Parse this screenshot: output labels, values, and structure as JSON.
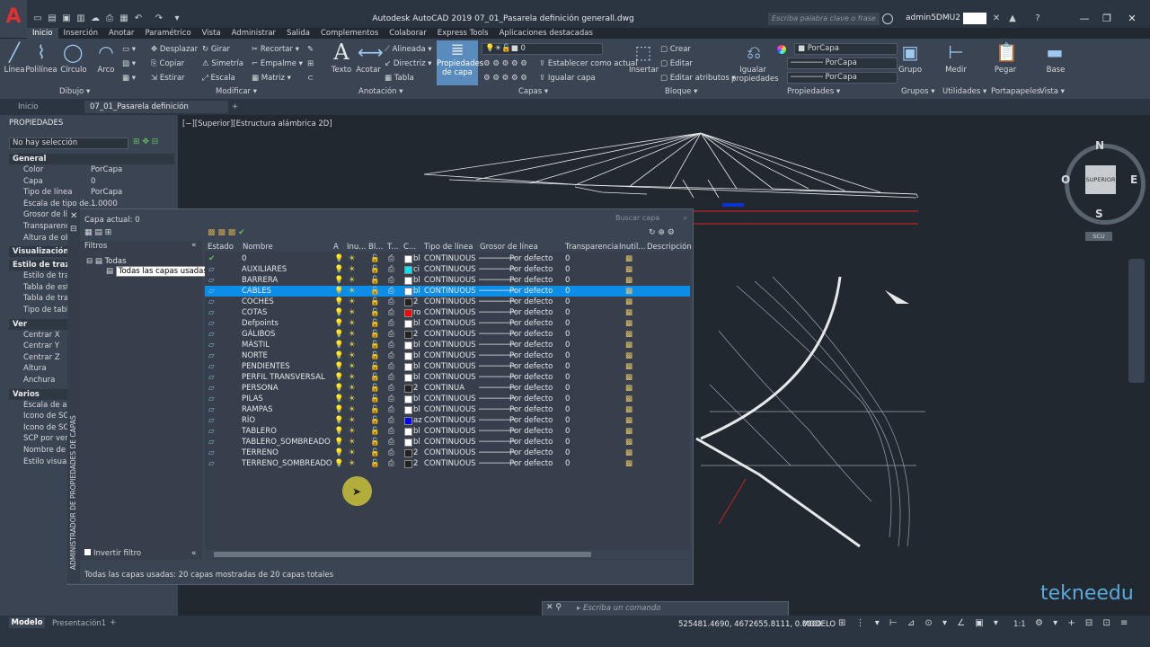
{
  "app": {
    "logo": "A",
    "title": "Autodesk AutoCAD 2019   07_01_Pasarela definición generall.dwg",
    "search_placeholder": "Escriba palabra clave o frase",
    "user": "admin5DMU2"
  },
  "ribbon_tabs": [
    "Inicio",
    "Inserción",
    "Anotar",
    "Paramétrico",
    "Vista",
    "Administrar",
    "Salida",
    "Complementos",
    "Colaborar",
    "Express Tools",
    "Aplicaciones destacadas"
  ],
  "ribbon": {
    "draw": {
      "label": "Dibujo",
      "tools": [
        "Línea",
        "Polilínea",
        "Círculo",
        "Arco"
      ]
    },
    "modify": {
      "label": "Modificar",
      "tools": [
        "Desplazar",
        "Girar",
        "Recortar",
        "Copiar",
        "Simetría",
        "Empalme",
        "Estirar",
        "Escala",
        "Matriz"
      ]
    },
    "annotation": {
      "label": "Anotación",
      "tools": [
        "Texto",
        "Acotar",
        "Alineada",
        "Directriz",
        "Tabla"
      ]
    },
    "layers": {
      "label": "Capas",
      "tools": [
        "Propiedades de capa",
        "Establecer como actual",
        "Igualar capa"
      ],
      "current": "0"
    },
    "block": {
      "label": "Bloque",
      "tools": [
        "Insertar",
        "Crear",
        "Editar",
        "Editar atributos"
      ]
    },
    "properties": {
      "label": "Propiedades",
      "tools": [
        "Igualar propiedades"
      ],
      "color": "PorCapa",
      "linetype": "PorCapa",
      "lineweight": "PorCapa"
    },
    "groups": {
      "label": "Grupos",
      "tools": [
        "Grupo"
      ]
    },
    "utilities": {
      "label": "Utilidades",
      "tools": [
        "Medir"
      ]
    },
    "clipboard": {
      "label": "Portapapeles",
      "tools": [
        "Pegar"
      ]
    },
    "view": {
      "label": "Vista",
      "tools": [
        "Base"
      ]
    }
  },
  "file_tabs": [
    "Inicio",
    "07_01_Pasarela definición generall*"
  ],
  "viewport_label": "[−][Superior][Estructura alámbrica 2D]",
  "viewcube": {
    "n": "N",
    "s": "S",
    "e": "E",
    "o": "O",
    "face": "SUPERIOR",
    "wcs": "SCU"
  },
  "properties_palette": {
    "title": "PROPIEDADES",
    "selection": "No hay selección",
    "sections": [
      {
        "name": "General",
        "rows": [
          [
            "Color",
            "PorCapa"
          ],
          [
            "Capa",
            "0"
          ],
          [
            "Tipo de línea",
            "PorCapa"
          ],
          [
            "Escala de tipo de...",
            "1.0000"
          ],
          [
            "Grosor de lín...",
            ""
          ],
          [
            "Transparencia",
            ""
          ],
          [
            "Altura de obj...",
            ""
          ]
        ]
      },
      {
        "name": "Visualización 3D",
        "rows": []
      },
      {
        "name": "Estilo de trazado",
        "rows": [
          [
            "Estilo de traza...",
            ""
          ],
          [
            "Tabla de estil...",
            ""
          ],
          [
            "Tabla de traz...",
            ""
          ],
          [
            "Tipo de tabla",
            ""
          ]
        ]
      },
      {
        "name": "Ver",
        "rows": [
          [
            "Centrar X",
            ""
          ],
          [
            "Centrar Y",
            ""
          ],
          [
            "Centrar Z",
            ""
          ],
          [
            "Altura",
            ""
          ],
          [
            "Anchura",
            ""
          ]
        ]
      },
      {
        "name": "Varios",
        "rows": [
          [
            "Escala de an...",
            ""
          ],
          [
            "Icono de SCP...",
            ""
          ],
          [
            "Icono de SCP...",
            ""
          ],
          [
            "SCP por vent...",
            ""
          ],
          [
            "Nombre de S...",
            ""
          ],
          [
            "Estilo visual",
            ""
          ]
        ]
      }
    ]
  },
  "layer_manager": {
    "side_title": "ADMINISTRADOR DE PROPIEDADES DE CAPAS",
    "current_layer": "Capa actual: 0",
    "search_placeholder": "Buscar capa",
    "filters_label": "Filtros",
    "tree_root": "Todas",
    "tree_child": "Todas las capas usadas",
    "invert_filter": "Invertir filtro",
    "status": "Todas las capas usadas: 20 capas mostradas de 20 capas totales",
    "columns": [
      "Estado",
      "Nombre",
      "A",
      "Inu...",
      "Bl...",
      "T...",
      "C...",
      "Tipo de línea",
      "Grosor de línea",
      "Transparencia",
      "Inutil...",
      "Descripción"
    ],
    "layers": [
      {
        "name": "0",
        "color": "bl",
        "hex": "#ffffff",
        "linetype": "CONTINUOUS",
        "lineweight": "Por defecto",
        "transparency": "0",
        "current": true
      },
      {
        "name": "AUXILIARES",
        "color": "ci",
        "hex": "#00e5ff",
        "linetype": "CONTINUOUS",
        "lineweight": "Por defecto",
        "transparency": "0"
      },
      {
        "name": "BARRERA",
        "color": "bl",
        "hex": "#ffffff",
        "linetype": "CONTINUOUS",
        "lineweight": "Por defecto",
        "transparency": "0"
      },
      {
        "name": "CABLES",
        "color": "bl",
        "hex": "#ffffff",
        "linetype": "CONTINUOUS",
        "lineweight": "Por defecto",
        "transparency": "0",
        "selected": true
      },
      {
        "name": "COCHES",
        "color": "2",
        "hex": "#222222",
        "linetype": "CONTINUOUS",
        "lineweight": "Por defecto",
        "transparency": "0"
      },
      {
        "name": "COTAS",
        "color": "ro",
        "hex": "#ff0000",
        "linetype": "CONTINUOUS",
        "lineweight": "Por defecto",
        "transparency": "0"
      },
      {
        "name": "Defpoints",
        "color": "bl",
        "hex": "#ffffff",
        "linetype": "CONTINUOUS",
        "lineweight": "Por defecto",
        "transparency": "0"
      },
      {
        "name": "GÁLIBOS",
        "color": "2",
        "hex": "#222222",
        "linetype": "CONTINUOUS",
        "lineweight": "Por defecto",
        "transparency": "0"
      },
      {
        "name": "MÁSTIL",
        "color": "bl",
        "hex": "#ffffff",
        "linetype": "CONTINUOUS",
        "lineweight": "Por defecto",
        "transparency": "0"
      },
      {
        "name": "NORTE",
        "color": "bl",
        "hex": "#ffffff",
        "linetype": "CONTINUOUS",
        "lineweight": "Por defecto",
        "transparency": "0"
      },
      {
        "name": "PENDIENTES",
        "color": "bl",
        "hex": "#ffffff",
        "linetype": "CONTINUOUS",
        "lineweight": "Por defecto",
        "transparency": "0"
      },
      {
        "name": "PERFIL TRANSVERSAL",
        "color": "bl",
        "hex": "#ffffff",
        "linetype": "CONTINUOUS",
        "lineweight": "Por defecto",
        "transparency": "0"
      },
      {
        "name": "PERSONA",
        "color": "2",
        "hex": "#222222",
        "linetype": "CONTINUA",
        "lineweight": "Por defecto",
        "transparency": "0"
      },
      {
        "name": "PILAS",
        "color": "bl",
        "hex": "#ffffff",
        "linetype": "CONTINUOUS",
        "lineweight": "Por defecto",
        "transparency": "0"
      },
      {
        "name": "RAMPAS",
        "color": "bl",
        "hex": "#ffffff",
        "linetype": "CONTINUOUS",
        "lineweight": "Por defecto",
        "transparency": "0"
      },
      {
        "name": "RÍO",
        "color": "az",
        "hex": "#0000ff",
        "linetype": "CONTINUOUS",
        "lineweight": "Por defecto",
        "transparency": "0"
      },
      {
        "name": "TABLERO",
        "color": "bl",
        "hex": "#ffffff",
        "linetype": "CONTINUOUS",
        "lineweight": "Por defecto",
        "transparency": "0"
      },
      {
        "name": "TABLERO_SOMBREADO",
        "color": "bl",
        "hex": "#ffffff",
        "linetype": "CONTINUOUS",
        "lineweight": "Por defecto",
        "transparency": "0"
      },
      {
        "name": "TERRENO",
        "color": "2",
        "hex": "#222222",
        "linetype": "CONTINUOUS",
        "lineweight": "Por defecto",
        "transparency": "0"
      },
      {
        "name": "TERRENO_SOMBREADO",
        "color": "2",
        "hex": "#222222",
        "linetype": "CONTINUOUS",
        "lineweight": "Por defecto",
        "transparency": "0"
      }
    ]
  },
  "command_line": {
    "placeholder": "Escriba un comando"
  },
  "status_bar": {
    "model_tabs": [
      "Modelo",
      "Presentación1"
    ],
    "coords": "525481.4690, 4672655.8111, 0.0000",
    "mode": "MODELO",
    "scale": "1:1"
  },
  "watermark": "tekneedu"
}
